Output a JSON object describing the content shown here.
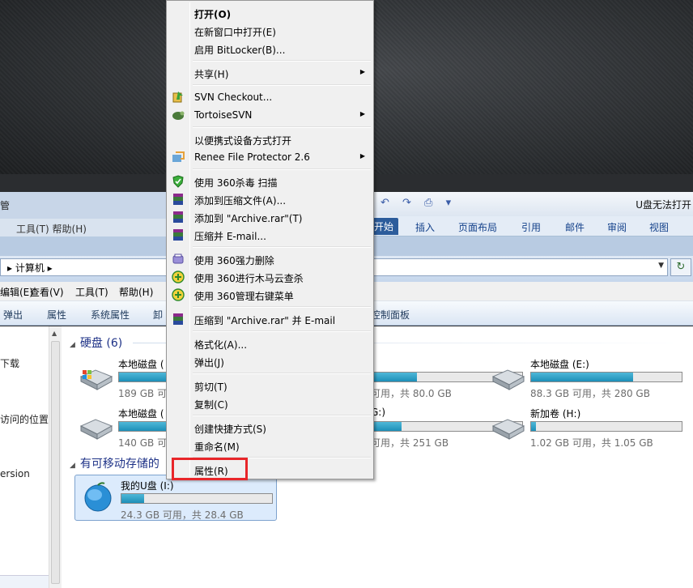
{
  "word": {
    "title": "U盘无法打开",
    "tabs": [
      "开始",
      "插入",
      "页面布局",
      "引用",
      "邮件",
      "审阅",
      "视图"
    ]
  },
  "explorer": {
    "old_title": "管",
    "old_menu": "工具(T)    帮助(H)",
    "address": "▸ 计算机 ▸",
    "menu": [
      "编辑(E)",
      "查看(V)",
      "工具(T)",
      "帮助(H)"
    ],
    "commands": [
      "弹出",
      "属性",
      "系统属性",
      "卸",
      "控制面板"
    ],
    "nav": [
      "下载",
      "访问的位置",
      "ersion"
    ],
    "groups": {
      "hard_disks": "硬盘 (6)",
      "removable": "有可移动存储的"
    },
    "drives": [
      {
        "name": "本地磁盘 (",
        "size": "189 GB 可用",
        "fill": 0.55
      },
      {
        "name": "",
        "size": "可用，共 80.0 GB",
        "fill": 0.3
      },
      {
        "name": "本地磁盘 (E:)",
        "size": "88.3 GB 可用，共 280 GB",
        "fill": 0.68
      },
      {
        "name": "本地磁盘 (",
        "size": "140 GB 可",
        "fill": 0.45
      },
      {
        "name": "G:)",
        "size": "可用，共 251 GB",
        "fill": 0.2
      },
      {
        "name": "新加卷 (H:)",
        "size": "1.02 GB 可用，共 1.05 GB",
        "fill": 0.03
      },
      {
        "name": "我的U盘 (I:)",
        "size": "24.3 GB 可用，共 28.4 GB",
        "fill": 0.15
      }
    ]
  },
  "context_menu": {
    "items": [
      {
        "label": "打开(O)",
        "bold": true
      },
      {
        "label": "在新窗口中打开(E)"
      },
      {
        "label": "启用 BitLocker(B)..."
      },
      {
        "label": "共享(H)",
        "submenu": true
      },
      {
        "label": "SVN Checkout..."
      },
      {
        "label": "TortoiseSVN",
        "submenu": true
      },
      {
        "label": "以便携式设备方式打开"
      },
      {
        "label": "Renee File Protector 2.6",
        "submenu": true
      },
      {
        "label": "使用 360杀毒 扫描"
      },
      {
        "label": "添加到压缩文件(A)..."
      },
      {
        "label": "添加到 \"Archive.rar\"(T)"
      },
      {
        "label": "压缩并 E-mail..."
      },
      {
        "label": "使用 360强力删除"
      },
      {
        "label": "使用 360进行木马云查杀"
      },
      {
        "label": "使用 360管理右键菜单"
      },
      {
        "label": "压缩到 \"Archive.rar\" 并 E-mail"
      },
      {
        "label": "格式化(A)..."
      },
      {
        "label": "弹出(J)"
      },
      {
        "label": "剪切(T)"
      },
      {
        "label": "复制(C)"
      },
      {
        "label": "创建快捷方式(S)"
      },
      {
        "label": "重命名(M)"
      },
      {
        "label": "属性(R)"
      }
    ],
    "submenu_glyph": "▶"
  },
  "colors": {
    "highlight": "#e8262a",
    "drive_bar": "#1d8fb8"
  }
}
